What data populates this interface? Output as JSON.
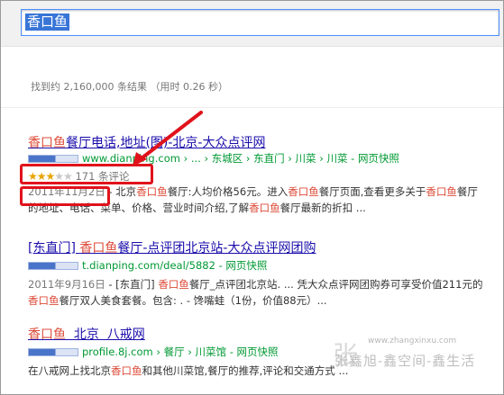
{
  "search": {
    "query": "香口鱼"
  },
  "stats": "找到约 2,160,000 条结果 （用时 0.26 秒）",
  "results": [
    {
      "title_hl": "香口鱼",
      "title_rest": "餐厅电话,地址(图)-北京-大众点评网",
      "url": "www.dianping.com",
      "crumbs": " › ... › 东城区 › 东直门 › 川菜 › 川菜 - ",
      "cache": "网页快照",
      "rating": {
        "stars_on": 3,
        "stars_total": 5,
        "count_text": "171 条评论"
      },
      "date": "2011年11月2日",
      "snippet": [
        {
          "t": " - 北京"
        },
        {
          "t": "香口鱼",
          "hl": true
        },
        {
          "t": "餐厅:人均价格56元。进入"
        },
        {
          "t": "香口鱼",
          "hl": true
        },
        {
          "t": "餐厅页面,查看更多关于"
        },
        {
          "t": "香口鱼",
          "hl": true
        },
        {
          "t": "餐厅的地址、电话、菜单、价格、营业时间介绍,了解"
        },
        {
          "t": "香口鱼",
          "hl": true
        },
        {
          "t": "餐厅最新的折扣 ..."
        }
      ]
    },
    {
      "title_pre": "[东直门] ",
      "title_hl": "香口鱼",
      "title_rest": "餐厅-点评团北京站-大众点评网团购",
      "url": "t.dianping.com/deal/5882",
      "crumbs": " - ",
      "cache": "网页快照",
      "date": "2011年9月16日",
      "snippet": [
        {
          "t": " - [东直门] "
        },
        {
          "t": "香口鱼",
          "hl": true
        },
        {
          "t": "餐厅_点评团北京站. ... 凭大众点评网团购券可享受价值211元的"
        },
        {
          "t": "香口鱼",
          "hl": true
        },
        {
          "t": "餐厅双人美食套餐。包含: . - 馋嘴蛙（1份，价值88元）..."
        }
      ]
    },
    {
      "title_hl": "香口鱼",
      "title_rest": "  北京  八戒网",
      "url": "profile.8j.com",
      "crumbs": " › 餐厅 › 川菜馆 - ",
      "cache": "网页快照",
      "snippet": [
        {
          "t": "在八戒网上找北京"
        },
        {
          "t": "香口鱼",
          "hl": true
        },
        {
          "t": "和其他川菜馆,餐厅的推荐,评论和交通方式 ..."
        }
      ]
    }
  ],
  "watermark": {
    "url": "www.zhangxinxu.com",
    "text": "张鑫旭-鑫空间-鑫生活",
    "mark": "张"
  },
  "colors": {
    "link": "#1a0dab",
    "highlight": "#dd4b39",
    "url": "#009933",
    "annotation": "#e0121b"
  }
}
